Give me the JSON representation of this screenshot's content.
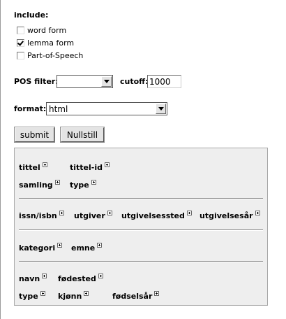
{
  "include": {
    "title": "include:",
    "options": [
      {
        "label": "word form",
        "checked": false
      },
      {
        "label": "lemma form",
        "checked": true
      },
      {
        "label": "Part-of-Speech",
        "checked": false
      }
    ]
  },
  "pos_filter": {
    "label": "POS filter:",
    "value": ""
  },
  "cutoff": {
    "label": "cutoff:",
    "value": "1000"
  },
  "format": {
    "label": "format:",
    "value": "html"
  },
  "buttons": {
    "submit": "submit",
    "reset": "Nullstill"
  },
  "metadata": {
    "group1": {
      "f1": "tittel",
      "f2": "tittel-id",
      "f3": "samling",
      "f4": "type"
    },
    "group2": {
      "f1": "issn/isbn",
      "f2": "utgiver",
      "f3": "utgivelsessted",
      "f4": "utgivelsesår"
    },
    "group3": {
      "f1": "kategori",
      "f2": "emne"
    },
    "group4": {
      "f1": "navn",
      "f2": "fødested",
      "f3": "type",
      "f4": "kjønn",
      "f5": "fødselsår"
    }
  }
}
